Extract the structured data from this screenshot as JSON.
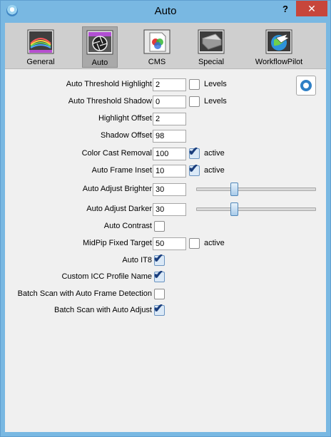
{
  "window": {
    "title": "Auto",
    "help_label": "?",
    "close_label": "✕"
  },
  "colors": {
    "titlebar": "#79b8e2",
    "close": "#c7463b",
    "checkmark": "#1a3d7c",
    "slider_thumb": "#a9cbe9"
  },
  "tabs": [
    {
      "label": "General",
      "icon": "general-icon",
      "active": false
    },
    {
      "label": "Auto",
      "icon": "auto-aperture-icon",
      "active": true
    },
    {
      "label": "CMS",
      "icon": "cms-icon",
      "active": false
    },
    {
      "label": "Special",
      "icon": "special-scanner-icon",
      "active": false
    },
    {
      "label": "WorkflowPilot",
      "icon": "workflowpilot-icon",
      "active": false
    }
  ],
  "fields": {
    "threshold_highlight": {
      "label": "Auto Threshold Highlight",
      "value": "2",
      "checkbox_label": "Levels",
      "checked": false
    },
    "threshold_shadow": {
      "label": "Auto Threshold Shadow",
      "value": "0",
      "checkbox_label": "Levels",
      "checked": false
    },
    "highlight_offset": {
      "label": "Highlight Offset",
      "value": "2"
    },
    "shadow_offset": {
      "label": "Shadow Offset",
      "value": "98"
    },
    "color_cast": {
      "label": "Color Cast Removal",
      "value": "100",
      "checkbox_label": "active",
      "checked": true
    },
    "frame_inset": {
      "label": "Auto Frame Inset",
      "value": "10",
      "checkbox_label": "active",
      "checked": true
    },
    "brighter": {
      "label": "Auto Adjust Brighter",
      "value": "30",
      "slider_fraction": 0.3
    },
    "darker": {
      "label": "Auto Adjust Darker",
      "value": "30",
      "slider_fraction": 0.3
    },
    "contrast": {
      "label": "Auto Contrast",
      "checked": false
    },
    "midpip": {
      "label": "MidPip Fixed Target",
      "value": "50",
      "checkbox_label": "active",
      "checked": false
    },
    "it8": {
      "label": "Auto IT8",
      "checked": true
    },
    "icc": {
      "label": "Custom ICC Profile Name",
      "checked": true
    },
    "batch_frame": {
      "label": "Batch Scan with Auto Frame Detection",
      "checked": false
    },
    "batch_adjust": {
      "label": "Batch Scan with Auto Adjust",
      "checked": true
    }
  },
  "checkmark_glyph": "✔",
  "quicktime_button": {
    "icon": "quicktime-icon"
  }
}
